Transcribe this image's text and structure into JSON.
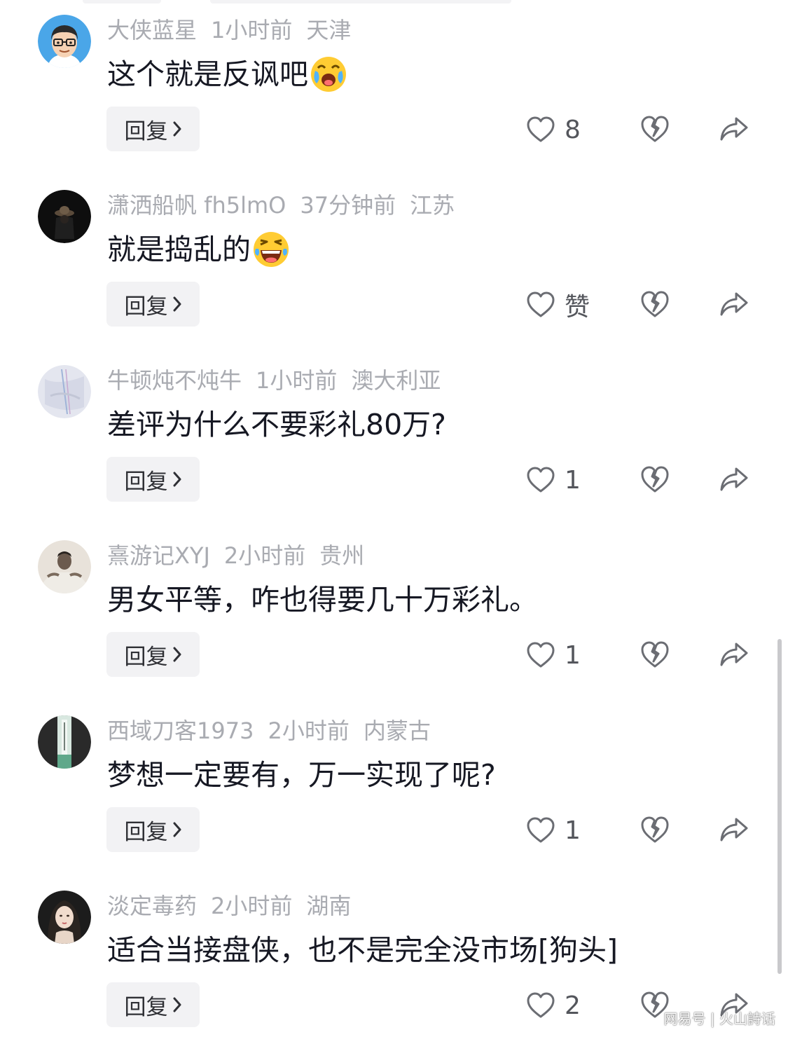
{
  "reply_label": "回复",
  "comments": [
    {
      "username": "大侠蓝星",
      "time": "1小时前",
      "location": "天津",
      "text": "这个就是反讽吧",
      "emoji": "crying-laughing-emoji",
      "like_count": "8"
    },
    {
      "username": "潇洒船帆 fh5lmO",
      "time": "37分钟前",
      "location": "江苏",
      "text": "就是捣乱的",
      "emoji": "laughing-tears-emoji",
      "like_count": "赞"
    },
    {
      "username": "牛顿炖不炖牛",
      "time": "1小时前",
      "location": "澳大利亚",
      "text": "差评为什么不要彩礼80万?",
      "like_count": "1"
    },
    {
      "username": "熹游记XYJ",
      "time": "2小时前",
      "location": "贵州",
      "text": "男女平等，咋也得要几十万彩礼。",
      "like_count": "1"
    },
    {
      "username": "西域刀客1973",
      "time": "2小时前",
      "location": "内蒙古",
      "text": "梦想一定要有，万一实现了呢?",
      "like_count": "1"
    },
    {
      "username": "淡定毒药",
      "time": "2小时前",
      "location": "湖南",
      "text": "适合当接盘侠，也不是完全没市场[狗头]",
      "like_count": "2"
    }
  ],
  "watermark": "网易号 | 火山詩话",
  "colors": {
    "meta_text": "#a9abb1",
    "body_text": "#161823",
    "reply_bg": "#f2f2f4",
    "icon_stroke": "#6b6d73"
  }
}
